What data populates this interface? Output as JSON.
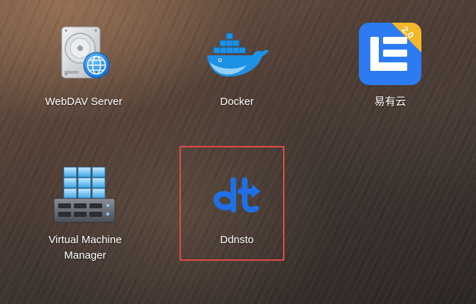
{
  "apps": [
    {
      "id": "webdav",
      "label": "WebDAV Server",
      "icon": "webdav-server-icon"
    },
    {
      "id": "docker",
      "label": "Docker",
      "icon": "docker-whale-icon"
    },
    {
      "id": "yiyouyun",
      "label": "易有云",
      "icon": "yiyouyun-icon",
      "badge": "2.0"
    },
    {
      "id": "vmm",
      "label_line1": "Virtual Machine",
      "label_line2": "Manager",
      "icon": "virtual-machine-manager-icon"
    },
    {
      "id": "ddnsto",
      "label": "Ddnsto",
      "icon": "ddnsto-icon",
      "highlighted": true
    }
  ],
  "colors": {
    "highlight_border": "#e24a4a",
    "docker_blue": "#1d91e6",
    "yiyouyun_blue": "#2d7bf2",
    "yiyouyun_badge": "#f5b72a",
    "ddnsto_blue": "#1f6fe6",
    "label_text": "#ffffff"
  }
}
